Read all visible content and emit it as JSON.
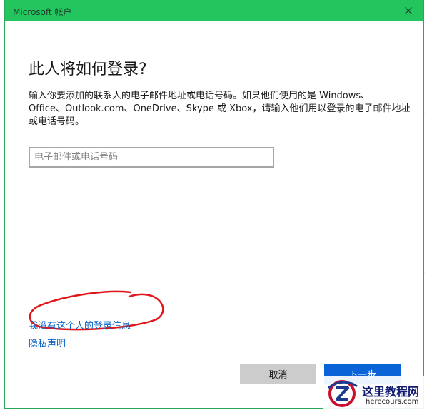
{
  "window": {
    "title": "Microsoft 帐户",
    "close_icon": "close-icon",
    "accent_color": "#22c55e"
  },
  "main": {
    "heading": "此人将如何登录?",
    "description_lines": [
      "输入你要添加的联系人的电子邮件地址或电话号码。如果他们使用的是 Windows、",
      "Office、Outlook.com、OneDrive、Skype 或 Xbox，请输入他们用以登录的电子邮件地址",
      "或电话号码。"
    ],
    "email_input": {
      "placeholder": "电子邮件或电话号码",
      "value": ""
    },
    "links": {
      "no_signin_info": "我没有这个人的登录信息",
      "privacy": "隐私声明"
    },
    "annotation_color": "#e0161a"
  },
  "buttons": {
    "cancel": "取消",
    "next": "下一步",
    "next_color": "#0a64d8"
  },
  "background": {
    "glyph": "Y"
  },
  "watermark": {
    "logo_icon": "z-logo-icon",
    "name": "这里教程网",
    "domain": "herecours.com"
  }
}
